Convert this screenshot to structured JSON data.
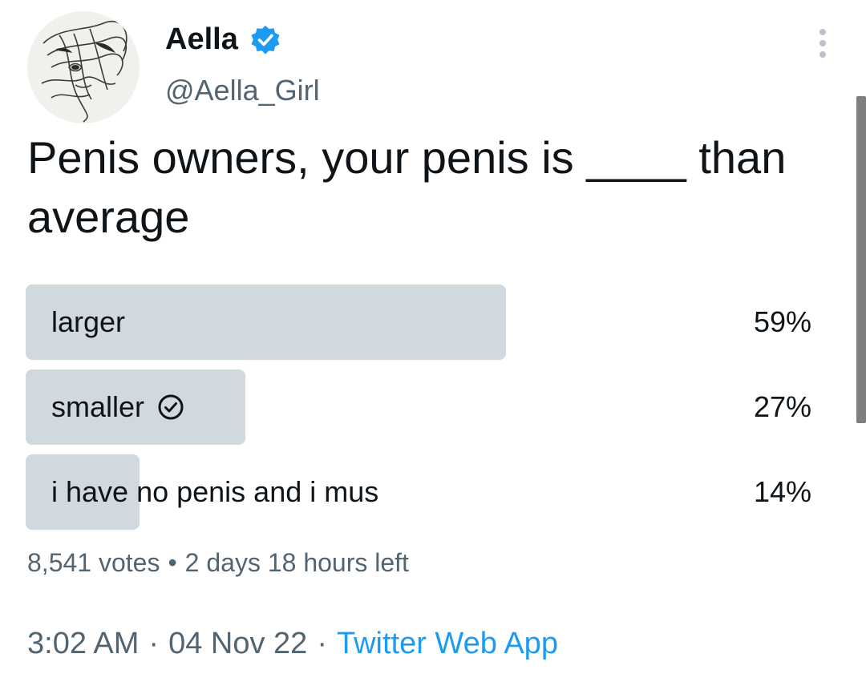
{
  "author": {
    "display_name": "Aella",
    "handle": "@Aella_Girl",
    "verified": true,
    "avatar_icon": "sketch-portrait-avatar",
    "verified_color": "#1d9bf0"
  },
  "tweet": {
    "text": "Penis owners, your penis is ____ than average"
  },
  "poll": {
    "options": [
      {
        "label": "larger",
        "percent_text": "59%",
        "fraction": 0.59,
        "selected": false
      },
      {
        "label": "smaller",
        "percent_text": "27%",
        "fraction": 0.27,
        "selected": true
      },
      {
        "label": "i have no penis and i mus",
        "percent_text": "14%",
        "fraction": 0.14,
        "selected": false
      }
    ],
    "votes": "8,541 votes",
    "separator": "•",
    "time_left": "2 days 18 hours left",
    "bar_color": "#cfd9de"
  },
  "footer": {
    "time": "3:02 AM",
    "separator": "·",
    "date": "04 Nov 22",
    "source": "Twitter Web App",
    "source_color": "#1d9bf0"
  },
  "icons": {
    "more": "more-vertical-icon",
    "selected_check": "check-circle-icon"
  }
}
